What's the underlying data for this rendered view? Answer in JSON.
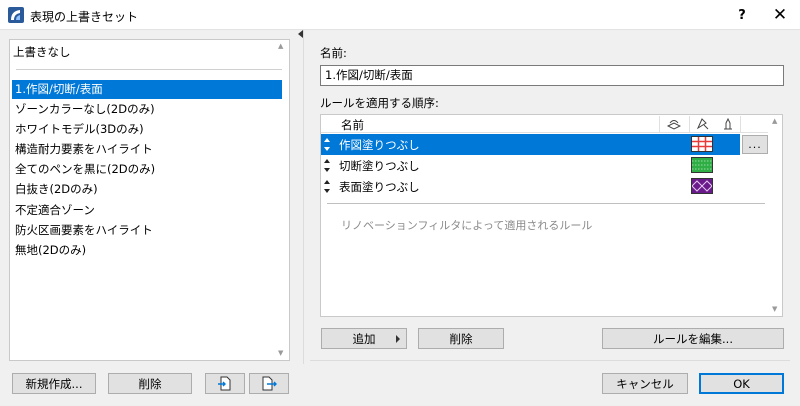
{
  "window": {
    "title": "表現の上書きセット",
    "help": "?",
    "close": "✕"
  },
  "left": {
    "no_override": "上書きなし",
    "items": [
      "1.作図/切断/表面",
      "ゾーンカラーなし(2Dのみ)",
      "ホワイトモデル(3Dのみ)",
      "構造耐力要素をハイライト",
      "全てのペンを黒に(2Dのみ)",
      "白抜き(2Dのみ)",
      "不定適合ゾーン",
      "防火区画要素をハイライト",
      "無地(2Dのみ)"
    ],
    "selected_index": 0,
    "buttons": {
      "new": "新規作成...",
      "delete": "削除"
    }
  },
  "right": {
    "name_label": "名前:",
    "name_value": "1.作図/切断/表面",
    "rules_label": "ルールを適用する順序:",
    "column_name": "名前",
    "rules": [
      {
        "name": "作図塗りつぶし",
        "swatch": "red-grid"
      },
      {
        "name": "切断塗りつぶし",
        "swatch": "green-hatch"
      },
      {
        "name": "表面塗りつぶし",
        "swatch": "purple-diamond"
      }
    ],
    "selected_rule": 0,
    "more_button": "...",
    "renovation_label": "リノベーションフィルタによって適用されるルール",
    "buttons": {
      "add": "追加",
      "delete": "削除",
      "edit_rules": "ルールを編集..."
    }
  },
  "footer": {
    "cancel": "キャンセル",
    "ok": "OK"
  },
  "colors": {
    "accent": "#0078d7",
    "swatch_red": "#e83a3a",
    "swatch_green": "#2fae45",
    "swatch_purple": "#6a1a8a"
  }
}
